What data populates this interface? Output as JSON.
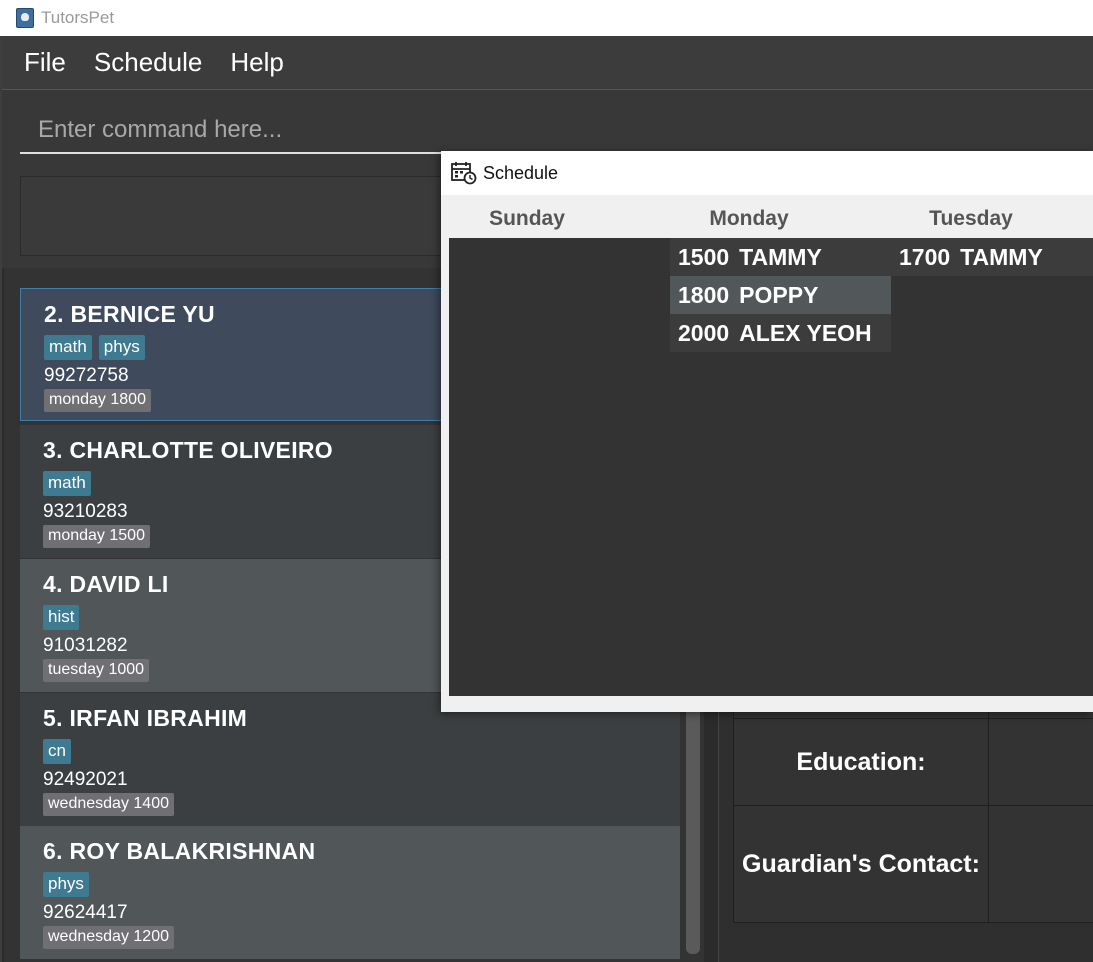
{
  "window": {
    "title": "TutorsPet"
  },
  "menu": {
    "file": "File",
    "schedule": "Schedule",
    "help": "Help"
  },
  "command": {
    "placeholder": "Enter command here..."
  },
  "students": [
    {
      "name": "2.  BERNICE YU",
      "tags": [
        "math",
        "phys"
      ],
      "phone": "99272758",
      "lesson": "monday 1800"
    },
    {
      "name": "3.  CHARLOTTE OLIVEIRO",
      "tags": [
        "math"
      ],
      "phone": "93210283",
      "lesson": "monday 1500"
    },
    {
      "name": "4.  DAVID LI",
      "tags": [
        "hist"
      ],
      "phone": "91031282",
      "lesson": "tuesday 1000"
    },
    {
      "name": "5.  IRFAN IBRAHIM",
      "tags": [
        "cn"
      ],
      "phone": "92492021",
      "lesson": "wednesday 1400"
    },
    {
      "name": "6.  ROY BALAKRISHNAN",
      "tags": [
        "phys"
      ],
      "phone": "92624417",
      "lesson": "wednesday 1200"
    }
  ],
  "details": {
    "education_label": "Education:",
    "guardian_label": "Guardian's Contact:"
  },
  "schedule": {
    "title": "Schedule",
    "days": [
      "Sunday",
      "Monday",
      "Tuesday"
    ],
    "monday": [
      {
        "time": "1500",
        "name": "TAMMY"
      },
      {
        "time": "1800",
        "name": "POPPY"
      },
      {
        "time": "2000",
        "name": "ALEX YEOH"
      }
    ],
    "tuesday": [
      {
        "time": "1700",
        "name": "TAMMY"
      }
    ]
  }
}
